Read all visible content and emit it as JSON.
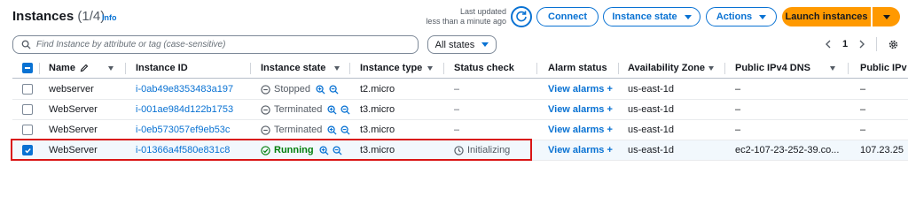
{
  "header": {
    "title": "Instances",
    "count": "(1/4)",
    "info": "Info",
    "last_updated_1": "Last updated",
    "last_updated_2": "less than a minute ago",
    "connect": "Connect",
    "instance_state": "Instance state",
    "actions": "Actions",
    "launch": "Launch instances"
  },
  "toolbar": {
    "search_placeholder": "Find Instance by attribute or tag (case-sensitive)",
    "states_filter": "All states",
    "page": "1"
  },
  "columns": [
    "Name",
    "Instance ID",
    "Instance state",
    "Instance type",
    "Status check",
    "Alarm status",
    "Availability Zone",
    "Public IPv4 DNS",
    "Public IPv"
  ],
  "rows": [
    {
      "name": "webserver",
      "id": "i-0ab49e8353483a197",
      "state": "Stopped",
      "type": "t2.micro",
      "check": "–",
      "alarm": "View alarms +",
      "az": "us-east-1d",
      "dns": "–",
      "ip": "–",
      "selected": false
    },
    {
      "name": "WebServer",
      "id": "i-001ae984d122b1753",
      "state": "Terminated",
      "type": "t3.micro",
      "check": "–",
      "alarm": "View alarms +",
      "az": "us-east-1d",
      "dns": "–",
      "ip": "–",
      "selected": false
    },
    {
      "name": "WebServer",
      "id": "i-0eb573057ef9eb53c",
      "state": "Terminated",
      "type": "t3.micro",
      "check": "–",
      "alarm": "View alarms +",
      "az": "us-east-1d",
      "dns": "–",
      "ip": "–",
      "selected": false
    },
    {
      "name": "WebServer",
      "id": "i-01366a4f580e831c8",
      "state": "Running",
      "type": "t3.micro",
      "check": "Initializing",
      "alarm": "View alarms +",
      "az": "us-east-1d",
      "dns": "ec2-107-23-252-39.co...",
      "ip": "107.23.25",
      "selected": true
    }
  ],
  "colors": {
    "link": "#0972d3",
    "launch": "#ff9900",
    "running": "#037f0c",
    "highlight": "#d91515"
  },
  "icons": [
    "info-link",
    "refresh-icon",
    "search-icon",
    "pencil-icon",
    "zoom-in-icon",
    "zoom-out-icon",
    "stopped-icon",
    "terminated-icon",
    "running-icon",
    "clock-icon",
    "settings-icon",
    "chevron-left-icon",
    "chevron-right-icon"
  ]
}
